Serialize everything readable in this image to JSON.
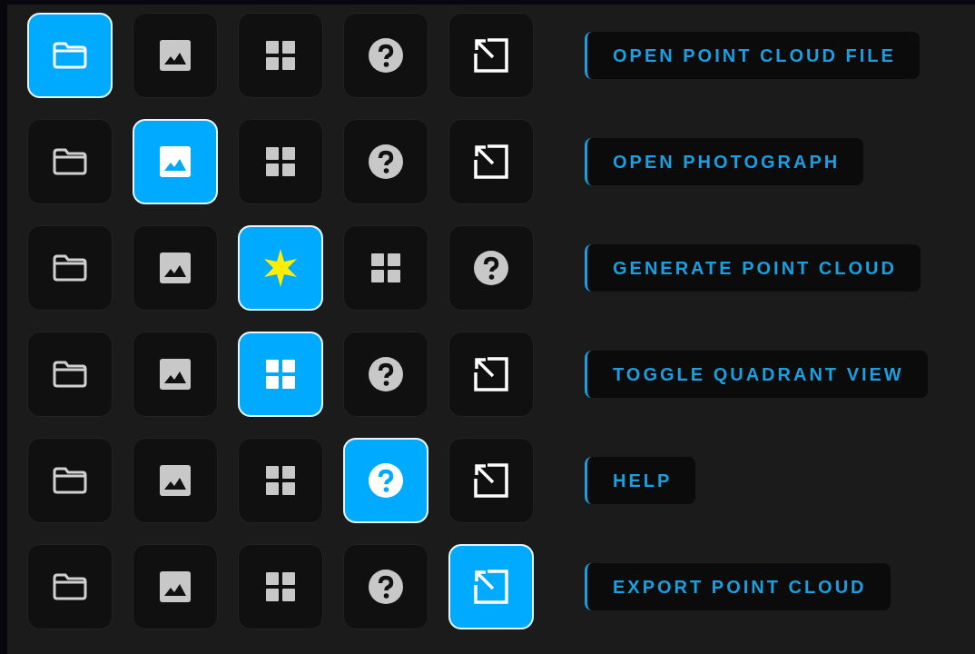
{
  "rows": [
    {
      "buttons": [
        {
          "kind": "folder",
          "selected": true
        },
        {
          "kind": "image",
          "selected": false
        },
        {
          "kind": "grid",
          "selected": false
        },
        {
          "kind": "help",
          "selected": false
        },
        {
          "kind": "export",
          "selected": false
        }
      ],
      "label": "OPEN POINT CLOUD FILE"
    },
    {
      "buttons": [
        {
          "kind": "folder",
          "selected": false
        },
        {
          "kind": "image",
          "selected": true
        },
        {
          "kind": "grid",
          "selected": false
        },
        {
          "kind": "help",
          "selected": false
        },
        {
          "kind": "export",
          "selected": false
        }
      ],
      "label": "OPEN PHOTOGRAPH"
    },
    {
      "buttons": [
        {
          "kind": "folder",
          "selected": false
        },
        {
          "kind": "image",
          "selected": false
        },
        {
          "kind": "generate",
          "selected": true
        },
        {
          "kind": "grid",
          "selected": false
        },
        {
          "kind": "help",
          "selected": false
        }
      ],
      "label": "GENERATE POINT CLOUD"
    },
    {
      "buttons": [
        {
          "kind": "folder",
          "selected": false
        },
        {
          "kind": "image",
          "selected": false
        },
        {
          "kind": "grid",
          "selected": true
        },
        {
          "kind": "help",
          "selected": false
        },
        {
          "kind": "export",
          "selected": false
        }
      ],
      "label": "TOGGLE QUADRANT VIEW"
    },
    {
      "buttons": [
        {
          "kind": "folder",
          "selected": false
        },
        {
          "kind": "image",
          "selected": false
        },
        {
          "kind": "grid",
          "selected": false
        },
        {
          "kind": "help",
          "selected": true
        },
        {
          "kind": "export",
          "selected": false
        }
      ],
      "label": "HELP"
    },
    {
      "buttons": [
        {
          "kind": "folder",
          "selected": false
        },
        {
          "kind": "image",
          "selected": false
        },
        {
          "kind": "grid",
          "selected": false
        },
        {
          "kind": "help",
          "selected": false
        },
        {
          "kind": "export",
          "selected": true
        }
      ],
      "label": "EXPORT POINT CLOUD"
    }
  ]
}
